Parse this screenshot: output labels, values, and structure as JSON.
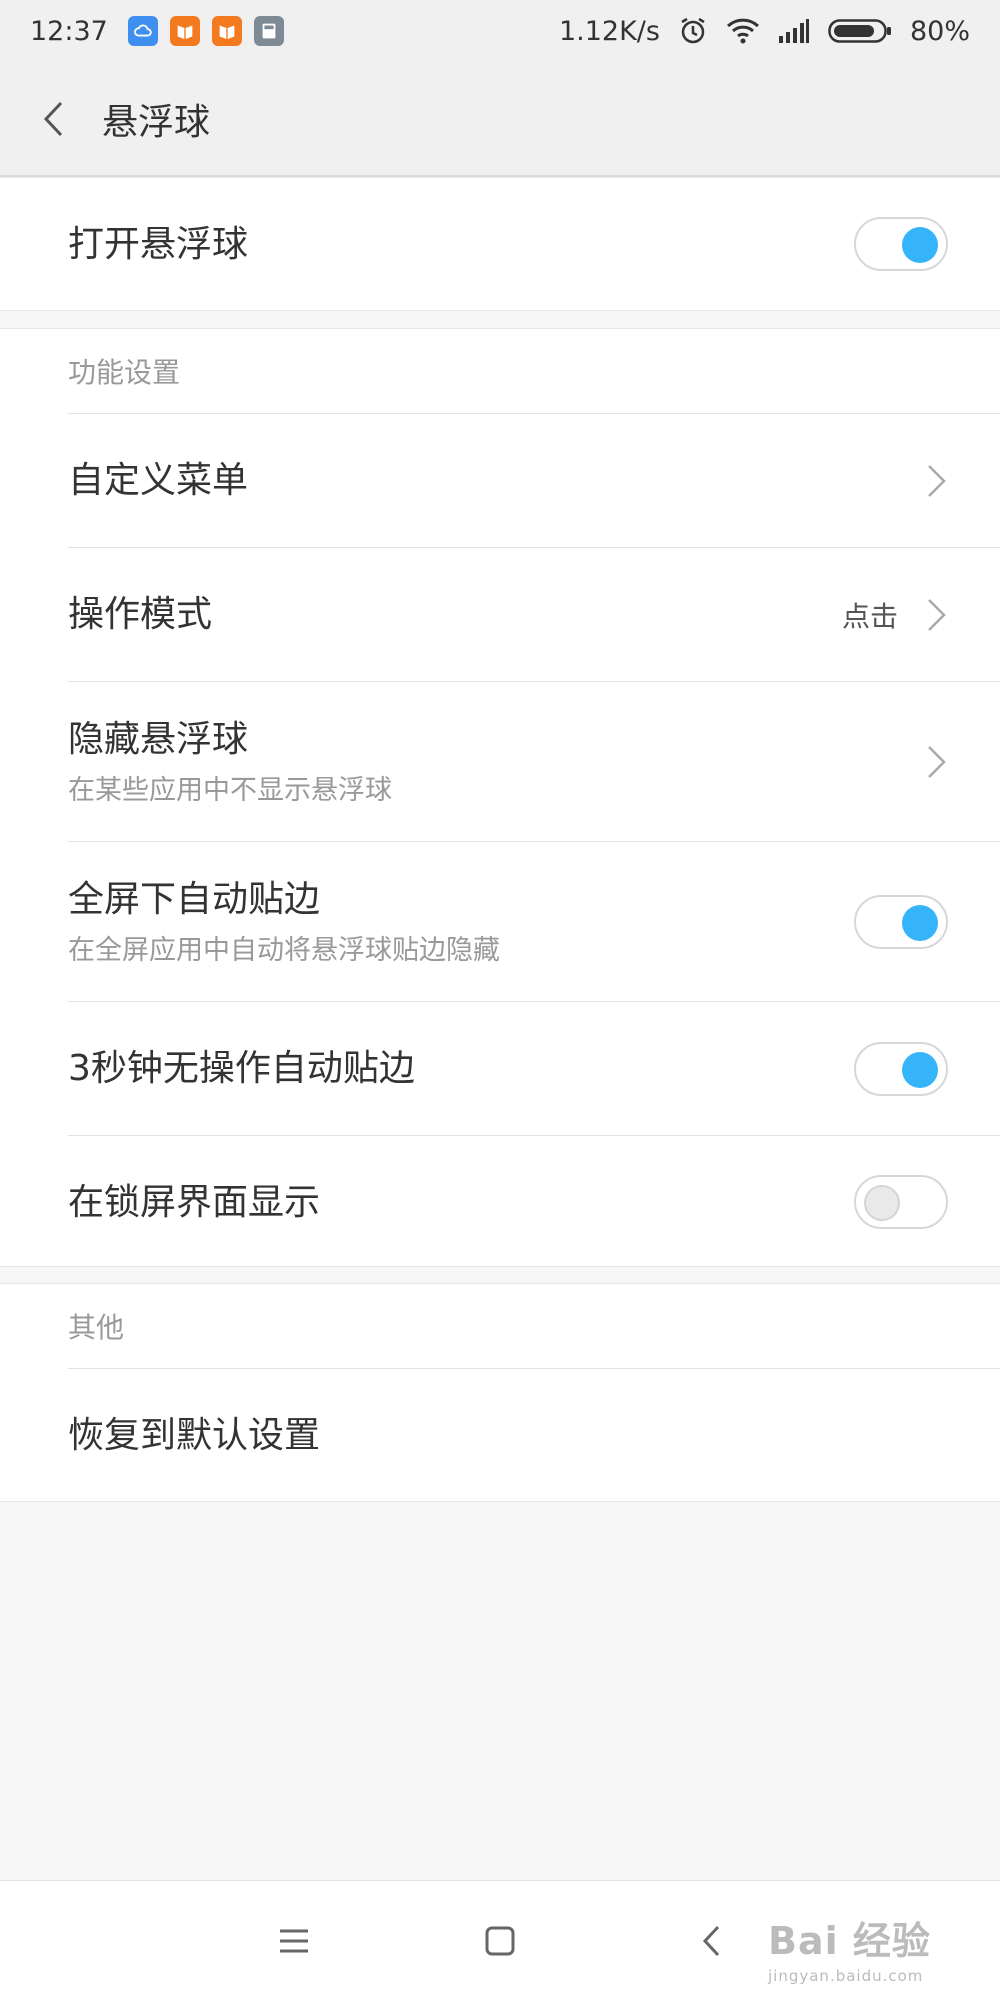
{
  "status_bar": {
    "time": "12:37",
    "net_speed": "1.12K/s",
    "battery": "80%",
    "notif_icons": [
      "cloud-app-icon",
      "book-app-icon",
      "book-app-icon",
      "calculator-app-icon"
    ]
  },
  "header": {
    "title": "悬浮球"
  },
  "main_toggle": {
    "label": "打开悬浮球",
    "on": true
  },
  "function_settings": {
    "section_label": "功能设置",
    "items": [
      {
        "title": "自定义菜单",
        "control": "chevron"
      },
      {
        "title": "操作模式",
        "value": "点击",
        "control": "chevron"
      },
      {
        "title": "隐藏悬浮球",
        "subtitle": "在某些应用中不显示悬浮球",
        "control": "chevron"
      },
      {
        "title": "全屏下自动贴边",
        "subtitle": "在全屏应用中自动将悬浮球贴边隐藏",
        "control": "toggle",
        "on": true
      },
      {
        "title": "3秒钟无操作自动贴边",
        "control": "toggle",
        "on": true
      },
      {
        "title": "在锁屏界面显示",
        "control": "toggle",
        "on": false
      }
    ]
  },
  "other": {
    "section_label": "其他",
    "reset_label": "恢复到默认设置"
  },
  "watermark": {
    "main": "Bai 经验",
    "url": "jingyan.baidu.com"
  },
  "colors": {
    "accent": "#35b4fa",
    "background": "#f6f6f6",
    "header": "#f0f0f0"
  }
}
